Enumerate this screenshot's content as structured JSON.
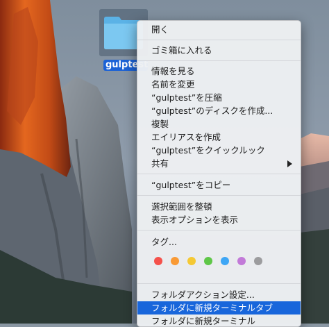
{
  "desktop": {
    "folder_label": "gulptest"
  },
  "menu": {
    "items": [
      {
        "label": "開く"
      },
      {
        "label": "ゴミ箱に入れる"
      },
      {
        "label": "情報を見る"
      },
      {
        "label": "名前を変更"
      },
      {
        "label": "“gulptest”を圧縮"
      },
      {
        "label": "“gulptest”のディスクを作成..."
      },
      {
        "label": "複製"
      },
      {
        "label": "エイリアスを作成"
      },
      {
        "label": "“gulptest”をクイックルック"
      },
      {
        "label": "共有"
      },
      {
        "label": "“gulptest”をコピー"
      },
      {
        "label": "選択範囲を整頓"
      },
      {
        "label": "表示オプションを表示"
      },
      {
        "label": "タグ..."
      },
      {
        "label": "フォルダアクション設定..."
      },
      {
        "label": "フォルダに新規ターミナルタブ"
      },
      {
        "label": "フォルダに新規ターミナル"
      }
    ],
    "tag_colors": [
      {
        "name": "red",
        "color": "#f5514b"
      },
      {
        "name": "orange",
        "color": "#f99a35"
      },
      {
        "name": "yellow",
        "color": "#f5c934"
      },
      {
        "name": "green",
        "color": "#5fc748"
      },
      {
        "name": "blue",
        "color": "#3ea6f5"
      },
      {
        "name": "purple",
        "color": "#c27ad8"
      },
      {
        "name": "gray",
        "color": "#9c9c9e"
      }
    ],
    "highlight_color": "#1866db"
  }
}
